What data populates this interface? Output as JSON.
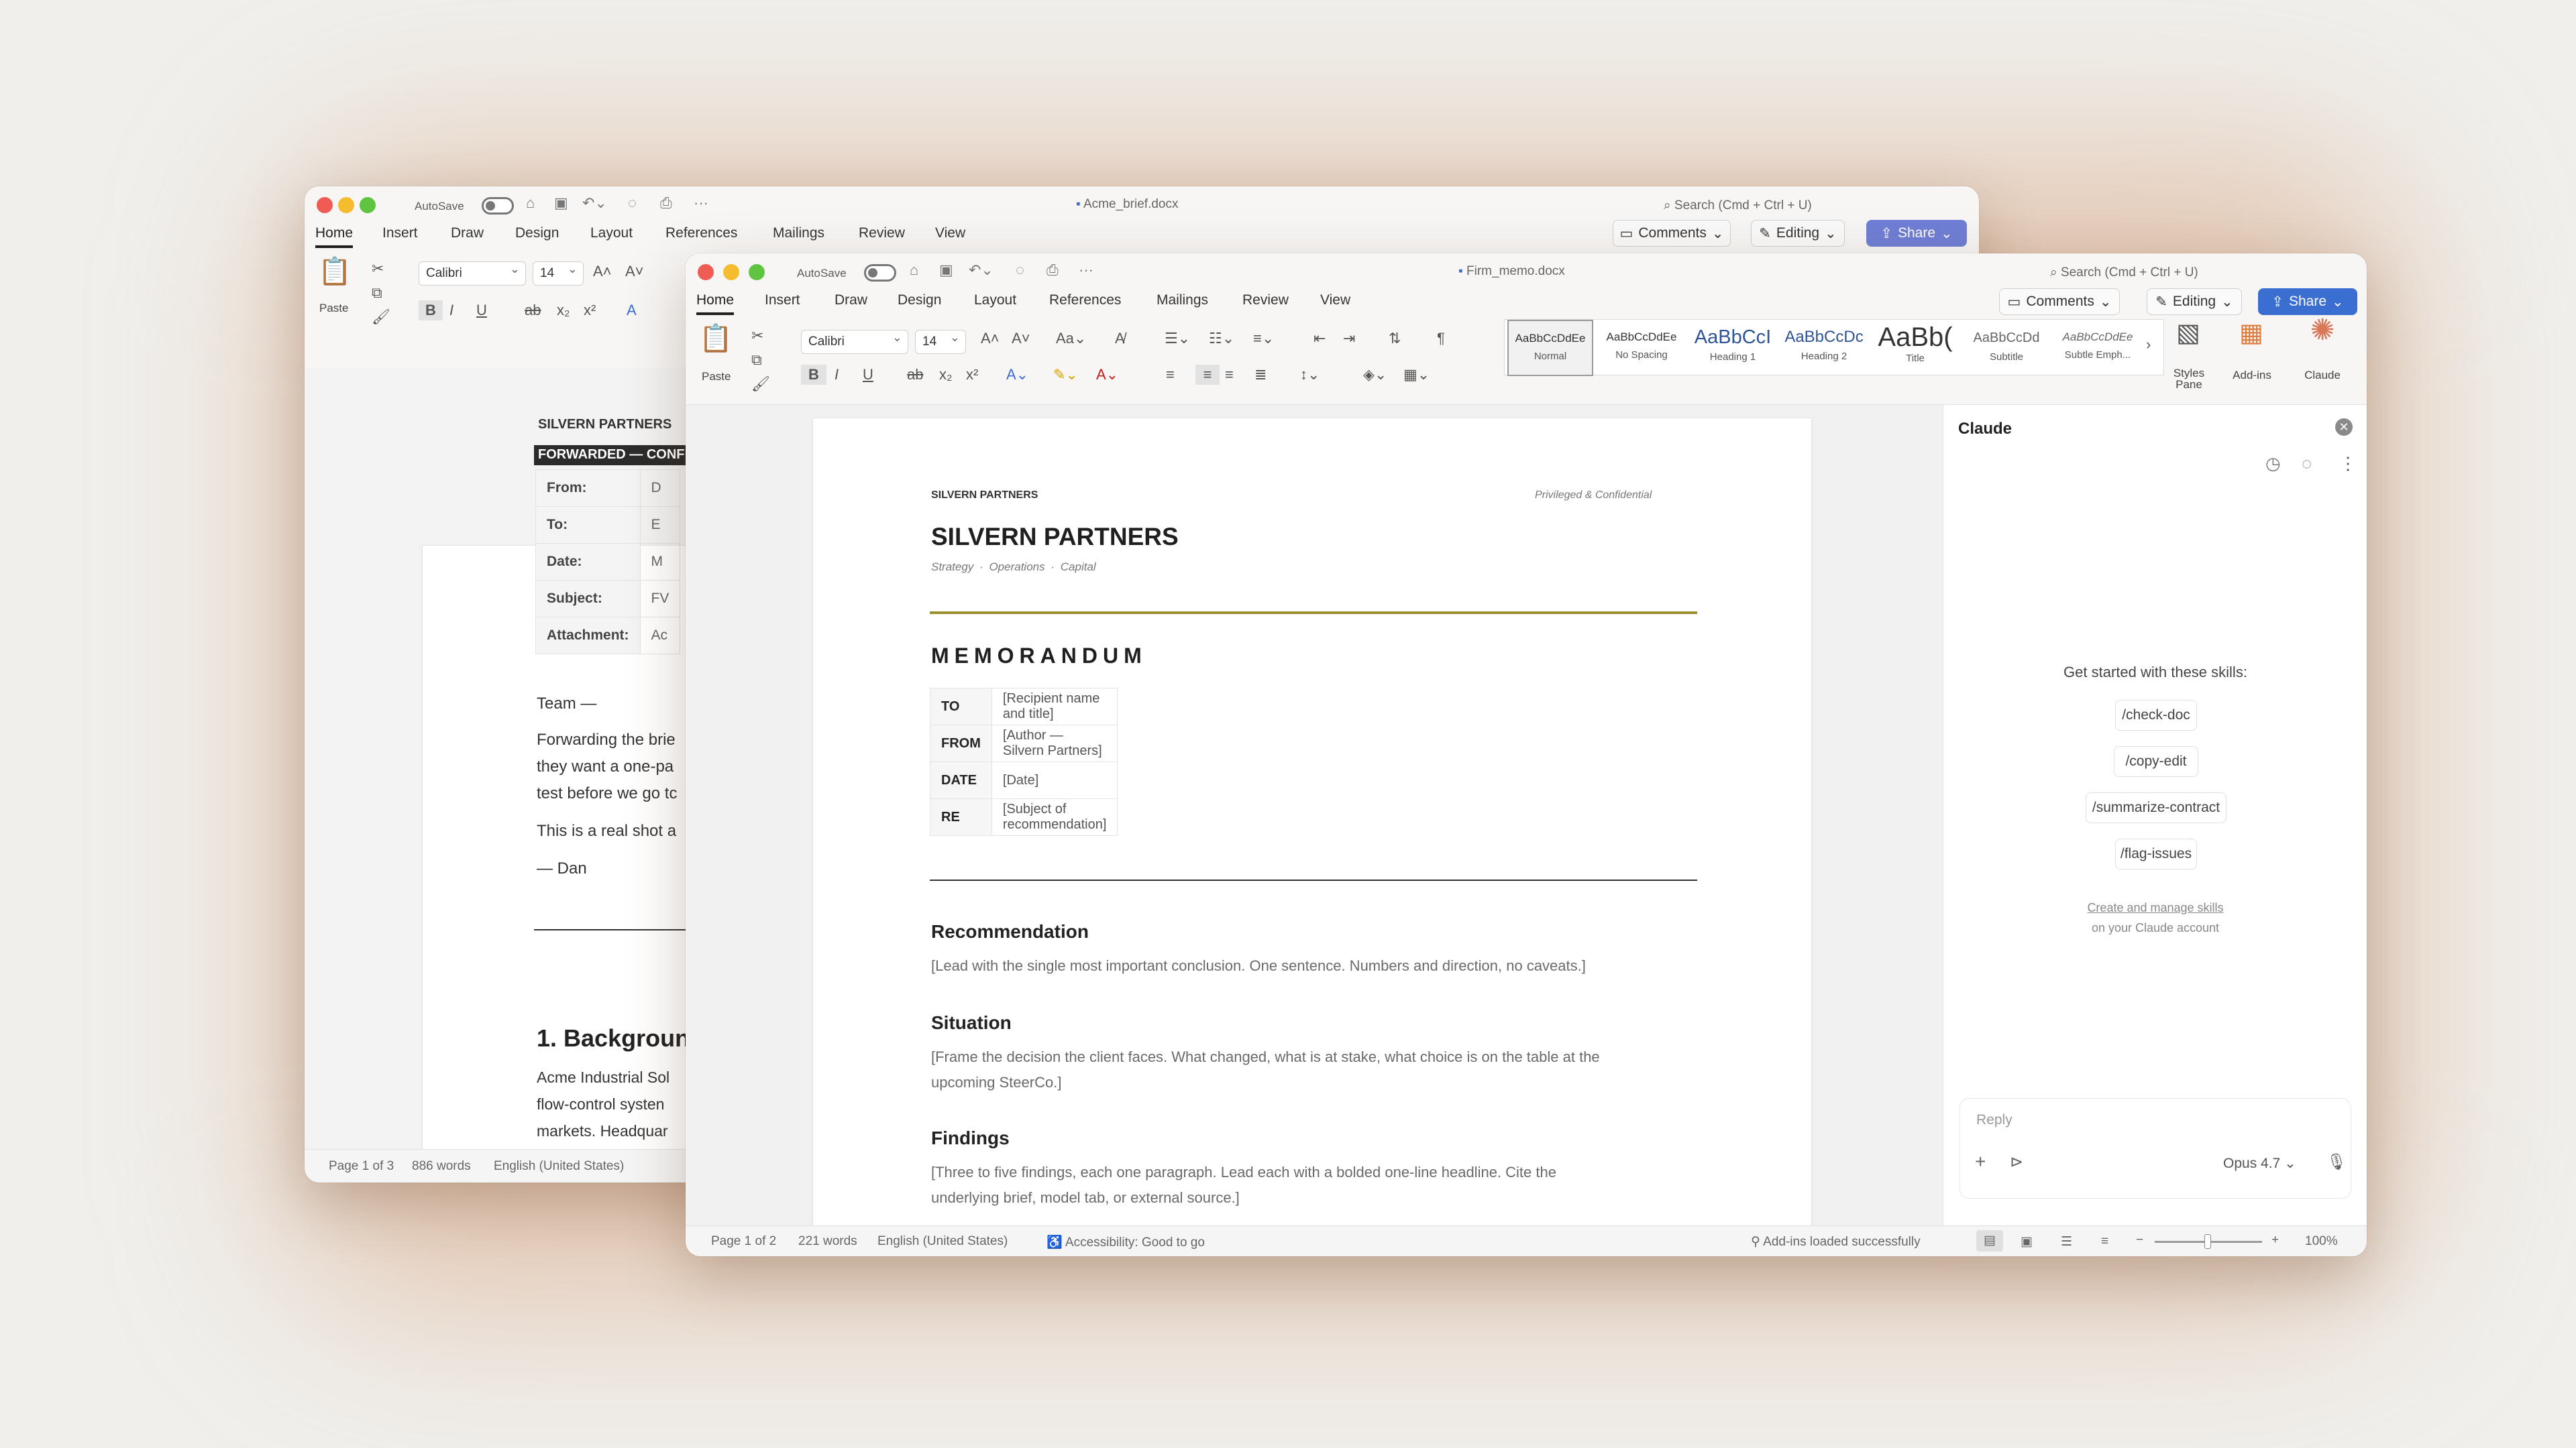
{
  "back_window": {
    "autosave_label": "AutoSave",
    "filename": "Acme_brief.docx",
    "search_placeholder": "Search (Cmd + Ctrl + U)",
    "tabs": [
      "Home",
      "Insert",
      "Draw",
      "Design",
      "Layout",
      "References",
      "Mailings",
      "Review",
      "View"
    ],
    "active_tab": "Home",
    "comments_label": "Comments",
    "editing_label": "Editing",
    "share_label": "Share",
    "paste_label": "Paste",
    "font_name": "Calibri",
    "font_size": "14",
    "doc": {
      "firm": "SILVERN PARTNERS",
      "banner": "FORWARDED — CONF",
      "rows": [
        {
          "key": "From:",
          "value": "D"
        },
        {
          "key": "To:",
          "value": "E"
        },
        {
          "key": "Date:",
          "value": "M"
        },
        {
          "key": "Subject:",
          "value": "FV"
        },
        {
          "key": "Attachment:",
          "value": "Ac"
        }
      ],
      "greeting": "Team —",
      "body_lines": [
        "Forwarding the brie",
        "they want a one-pa",
        "test before we go tc"
      ],
      "body2": "This is a real shot a",
      "signoff": "— Dan",
      "section_heading": "1. Backgroun",
      "section_lines": [
        "Acme Industrial Sol",
        "flow-control systen",
        "markets. Headquar"
      ]
    },
    "status": {
      "page": "Page 1 of 3",
      "words": "886 words",
      "language": "English (United States)"
    }
  },
  "front_window": {
    "autosave_label": "AutoSave",
    "filename": "Firm_memo.docx",
    "search_placeholder": "Search (Cmd + Ctrl + U)",
    "tabs": [
      "Home",
      "Insert",
      "Draw",
      "Design",
      "Layout",
      "References",
      "Mailings",
      "Review",
      "View"
    ],
    "active_tab": "Home",
    "comments_label": "Comments",
    "editing_label": "Editing",
    "share_label": "Share",
    "paste_label": "Paste",
    "font_name": "Calibri",
    "font_size": "14",
    "styles": [
      {
        "sample": "AaBbCcDdEe",
        "name": "Normal"
      },
      {
        "sample": "AaBbCcDdEe",
        "name": "No Spacing"
      },
      {
        "sample": "AaBbCcI",
        "name": "Heading 1"
      },
      {
        "sample": "AaBbCcDc",
        "name": "Heading 2"
      },
      {
        "sample": "AaBb(",
        "name": "Title"
      },
      {
        "sample": "AaBbCcDd",
        "name": "Subtitle"
      },
      {
        "sample": "AaBbCcDdEe",
        "name": "Subtle Emph..."
      }
    ],
    "styles_pane_label": [
      "Styles",
      "Pane"
    ],
    "addins_label": "Add-ins",
    "claude_label": "Claude",
    "doc": {
      "firm_small": "SILVERN PARTNERS",
      "privileged": "Privileged & Confidential",
      "firm_title": "SILVERN PARTNERS",
      "tagline": [
        "Strategy",
        "·",
        "Operations",
        "·",
        "Capital"
      ],
      "memo_title": "MEMORANDUM",
      "memo_rows": [
        {
          "key": "TO",
          "value": "[Recipient name and title]"
        },
        {
          "key": "FROM",
          "value": "[Author — Silvern Partners]"
        },
        {
          "key": "DATE",
          "value": "[Date]"
        },
        {
          "key": "RE",
          "value": "[Subject of recommendation]"
        }
      ],
      "sections": [
        {
          "heading": "Recommendation",
          "lines": [
            "[Lead with the single most important conclusion. One sentence. Numbers and direction, no caveats.]"
          ]
        },
        {
          "heading": "Situation",
          "lines": [
            "[Frame the decision the client faces. What changed, what is at stake, what choice is on the table at the",
            "upcoming SteerCo.]"
          ]
        },
        {
          "heading": "Findings",
          "lines": [
            "[Three to five findings, each one paragraph. Lead each with a bolded one-line headline. Cite the",
            "underlying brief, model tab, or external source.]"
          ]
        }
      ]
    },
    "claude_panel": {
      "title": "Claude",
      "prompt": "Get started with these skills:",
      "skills": [
        "/check-doc",
        "/copy-edit",
        "/summarize-contract",
        "/flag-issues"
      ],
      "manage_link": "Create and manage skills",
      "manage_sub": "on your Claude account",
      "reply_placeholder": "Reply",
      "model": "Opus 4.7"
    },
    "status": {
      "page": "Page 1 of 2",
      "words": "221 words",
      "language": "English (United States)",
      "accessibility": "Accessibility: Good to go",
      "addins": "Add-ins loaded successfully",
      "zoom": "100%"
    }
  }
}
